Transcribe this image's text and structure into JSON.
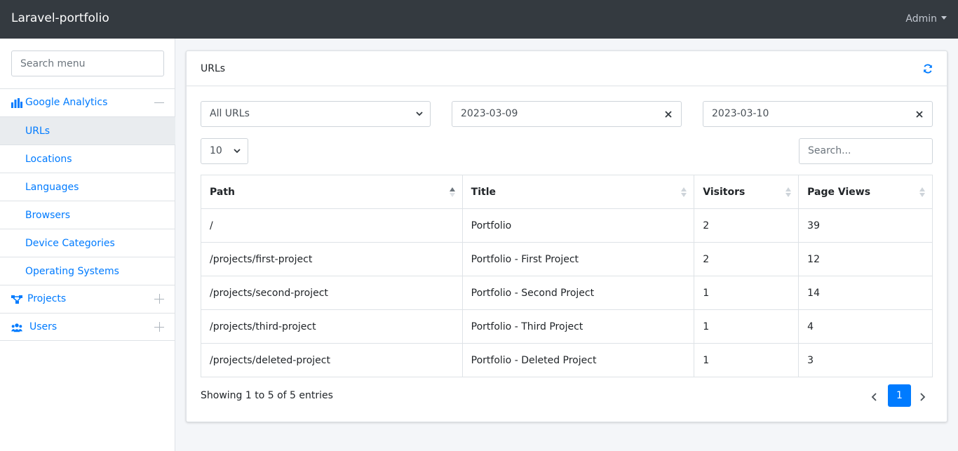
{
  "navbar": {
    "brand": "Laravel-portfolio",
    "user": "Admin"
  },
  "sidebar": {
    "search_placeholder": "Search menu",
    "items": [
      {
        "label": "Google Analytics",
        "icon": "bar-chart-icon",
        "expanded": true
      },
      {
        "label": "URLs",
        "active": true
      },
      {
        "label": "Locations"
      },
      {
        "label": "Languages"
      },
      {
        "label": "Browsers"
      },
      {
        "label": "Device Categories"
      },
      {
        "label": "Operating Systems"
      },
      {
        "label": "Projects",
        "icon": "sitemap-icon",
        "expanded": false
      },
      {
        "label": "Users",
        "icon": "users-icon",
        "expanded": false
      }
    ]
  },
  "card": {
    "title": "URLs",
    "filters": {
      "url_select": "All URLs",
      "date_from": "2023-03-09",
      "date_to": "2023-03-10",
      "page_length": "10",
      "search_placeholder": "Search..."
    },
    "table": {
      "columns": [
        "Path",
        "Title",
        "Visitors",
        "Page Views"
      ],
      "rows": [
        [
          "/",
          "Portfolio",
          "2",
          "39"
        ],
        [
          "/projects/first-project",
          "Portfolio - First Project",
          "2",
          "12"
        ],
        [
          "/projects/second-project",
          "Portfolio - Second Project",
          "1",
          "14"
        ],
        [
          "/projects/third-project",
          "Portfolio - Third Project",
          "1",
          "4"
        ],
        [
          "/projects/deleted-project",
          "Portfolio - Deleted Project",
          "1",
          "3"
        ]
      ]
    },
    "info": "Showing 1 to 5 of 5 entries",
    "current_page": "1"
  },
  "colors": {
    "accent": "#007bff",
    "navbar": "#343a40",
    "active_bg": "#e9ecef"
  }
}
